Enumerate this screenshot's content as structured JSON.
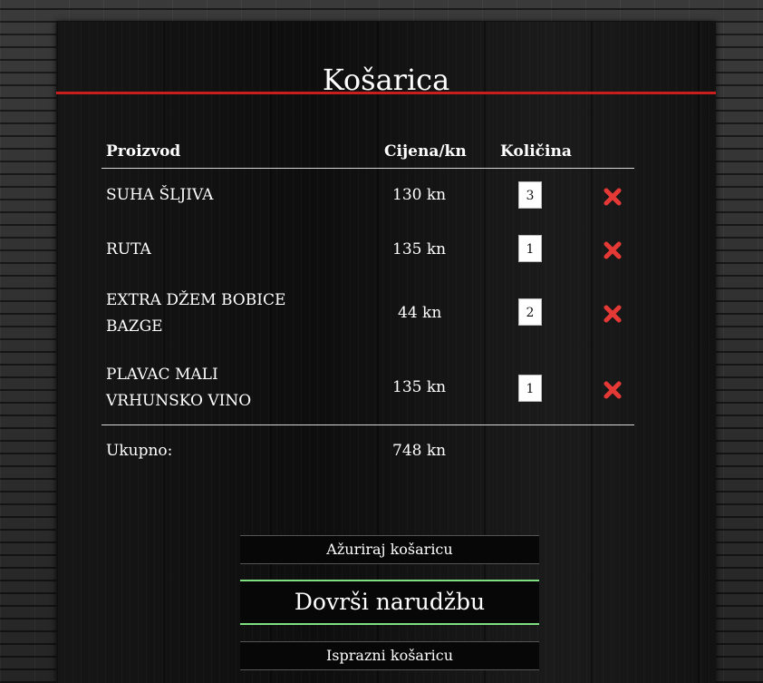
{
  "cart": {
    "title": "Košarica",
    "headers": {
      "product": "Proizvod",
      "price": "Cijena/kn",
      "quantity": "Količina"
    },
    "items": [
      {
        "name_line1": "SUHA ŠLJIVA",
        "name_line2": "",
        "price": "130 kn",
        "quantity": "3",
        "remove_icon": "red-x-icon"
      },
      {
        "name_line1": "RUTA",
        "name_line2": "",
        "price": "135 kn",
        "quantity": "1",
        "remove_icon": "red-x-icon"
      },
      {
        "name_line1": "EXTRA DŽEM BOBICE",
        "name_line2": "BAZGE",
        "price": "44 kn",
        "quantity": "2",
        "remove_icon": "red-x-icon"
      },
      {
        "name_line1": "PLAVAC MALI",
        "name_line2": "VRHUNSKO VINO",
        "price": "135 kn",
        "quantity": "1",
        "remove_icon": "red-x-icon"
      }
    ],
    "total_label": "Ukupno:",
    "total_value": "748 kn"
  },
  "actions": {
    "update_label": "Ažuriraj košaricu",
    "checkout_label": "Dovrši narudžbu",
    "empty_label": "Isprazni košaricu"
  },
  "colors": {
    "accent_red": "#c81e1e",
    "checkout_green": "#7ee07e",
    "remove_red": "#e53935"
  }
}
